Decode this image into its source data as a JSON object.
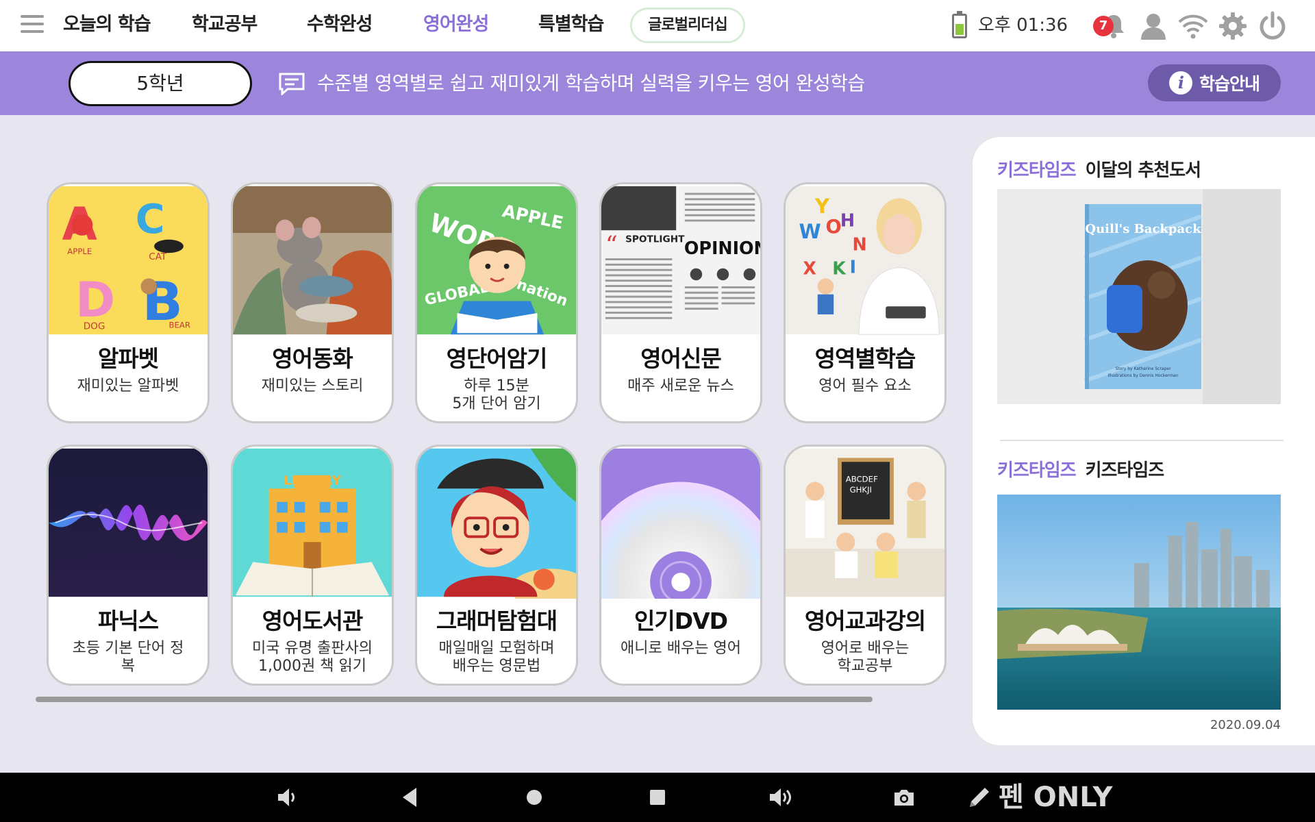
{
  "nav": {
    "items": [
      "오늘의 학습",
      "학교공부",
      "수학완성",
      "영어완성",
      "특별학습"
    ],
    "active_index": 3,
    "pill": "글로벌리더십",
    "active_color": "#8a6fd9"
  },
  "status": {
    "clock": "오후 01:36",
    "notification_count": "7"
  },
  "banner": {
    "grade": "5학년",
    "description": "수준별 영역별로 쉽고 재미있게 학습하며 실력을 키우는 영어 완성학습",
    "guide_button": "학습안내",
    "color": "#9b86dc"
  },
  "cards": [
    {
      "title": "알파벳",
      "desc": [
        "재미있는 알파벳"
      ],
      "icon": "alphabet-illustration"
    },
    {
      "title": "영어동화",
      "desc": [
        "재미있는 스토리"
      ],
      "icon": "mouse-storybook-illustration"
    },
    {
      "title": "영단어암기",
      "desc": [
        "하루 15분",
        "5개 단어 암기"
      ],
      "icon": "boy-reading-illustration"
    },
    {
      "title": "영어신문",
      "desc": [
        "매주 새로운 뉴스"
      ],
      "icon": "newspaper-illustration"
    },
    {
      "title": "영역별학습",
      "desc": [
        "영어 필수 요소"
      ],
      "icon": "teacher-letters-illustration"
    },
    {
      "title": "파닉스",
      "desc": [
        "초등 기본 단어 정",
        "복"
      ],
      "icon": "sound-wave-illustration"
    },
    {
      "title": "영어도서관",
      "desc": [
        "미국 유명 출판사의",
        "1,000권 책 읽기"
      ],
      "icon": "library-book-illustration"
    },
    {
      "title": "그래머탐험대",
      "desc": [
        "매일매일 모험하며",
        "배우는 영문법"
      ],
      "icon": "pirate-girl-illustration"
    },
    {
      "title": "인기DVD",
      "desc": [
        "애니로 배우는 영어"
      ],
      "icon": "dvd-disc-illustration"
    },
    {
      "title": "영어교과강의",
      "desc": [
        "영어로 배우는",
        "학교공부"
      ],
      "icon": "classroom-kids-illustration"
    }
  ],
  "art_text": {
    "alphabet": [
      "A",
      "C",
      "D",
      "B",
      "APPLE",
      "CAT",
      "DOG",
      "BEAR"
    ],
    "words": [
      "WORD",
      "APPLE",
      "GLOBAL",
      "nation"
    ],
    "news": [
      "SPOTLIGHT",
      "OPINION"
    ],
    "letters": [
      "Y",
      "W",
      "O",
      "X",
      "H",
      "K",
      "N",
      "I"
    ],
    "library": "LIBRARY",
    "chalkboard": [
      "ABCDEF",
      "GHKJI"
    ]
  },
  "side": {
    "brand": "키즈타임즈",
    "section1": "이달의 추천도서",
    "book_title": "Quill's Backpack",
    "book_credit": [
      "Story by Katharine Scraper",
      "Illustrations by Dennis Hockerman"
    ],
    "section2": "키즈타임즈",
    "date": "2020.09.04"
  },
  "sysbar": {
    "pen_only": "펜 ONLY"
  }
}
